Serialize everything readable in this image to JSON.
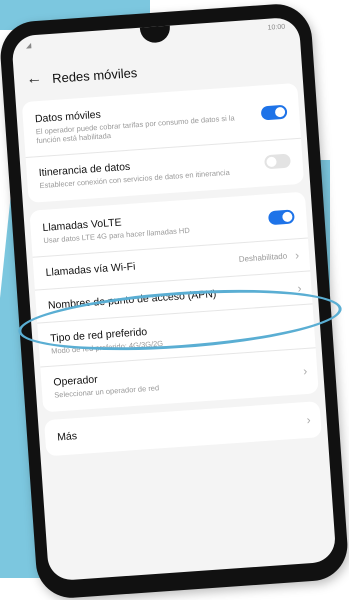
{
  "status_bar": {
    "time": "10:00"
  },
  "header": {
    "title": "Redes móviles"
  },
  "sections": [
    {
      "rows": [
        {
          "title": "Datos móviles",
          "subtitle": "El operador puede cobrar tarifas por consumo de datos si la función está habilitada",
          "control": "toggle-on"
        },
        {
          "title": "Itinerancia de datos",
          "subtitle": "Establecer conexión con servicios de datos en itinerancia",
          "control": "toggle-off"
        }
      ]
    },
    {
      "rows": [
        {
          "title": "Llamadas VoLTE",
          "subtitle": "Usar datos LTE 4G para hacer llamadas HD",
          "control": "toggle-on"
        },
        {
          "title": "Llamadas vía Wi-Fi",
          "value": "Deshabilitado",
          "control": "chevron"
        },
        {
          "title": "Nombres de punto de acceso (APN)",
          "control": "chevron"
        },
        {
          "title": "Tipo de red preferido",
          "subtitle": "Modo de red preferido: 4G/3G/2G"
        },
        {
          "title": "Operador",
          "subtitle": "Seleccionar un operador de red",
          "control": "chevron"
        }
      ]
    },
    {
      "rows": [
        {
          "title": "Más",
          "control": "chevron"
        }
      ]
    }
  ],
  "icons": {
    "back": "arrow-left-icon",
    "chevron": "chevron-right-icon"
  },
  "colors": {
    "accent": "#1e73e8",
    "highlight": "#5aaed3",
    "background_shape": "#7cc7df"
  }
}
